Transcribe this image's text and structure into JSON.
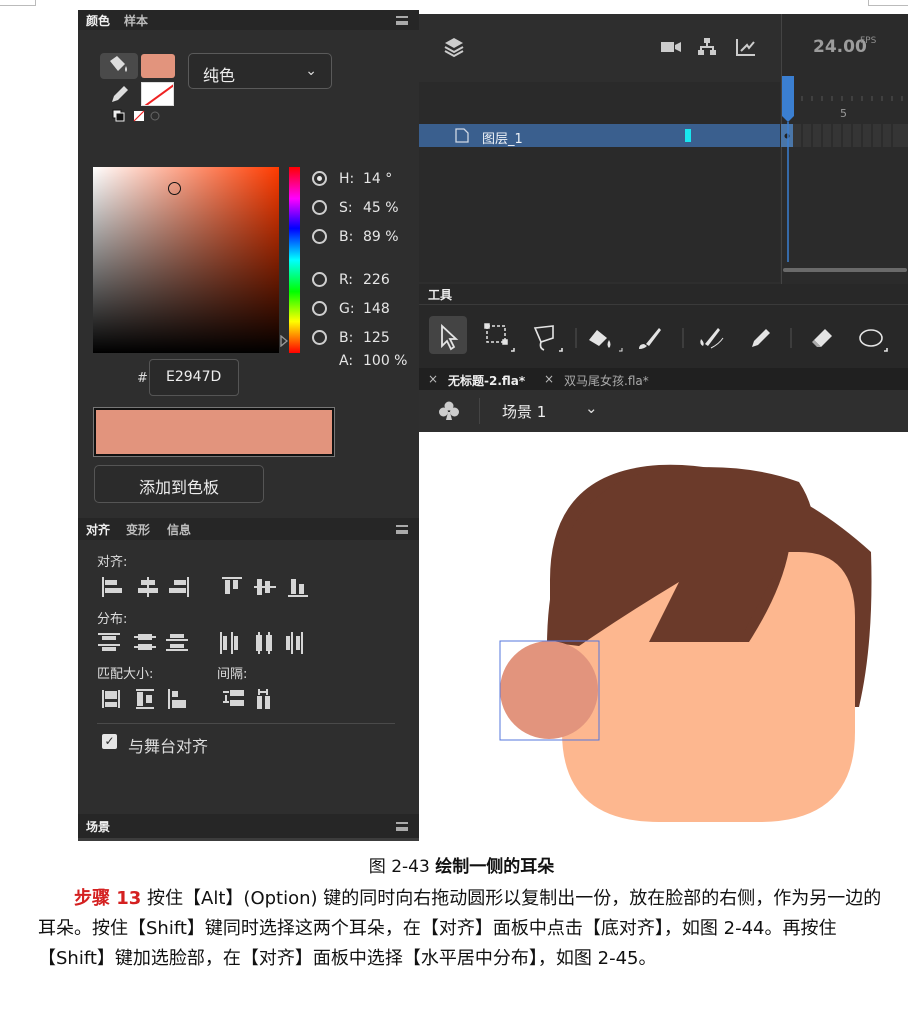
{
  "colors": {
    "fill": "#E2947D",
    "face": "#FDB78F",
    "hair": "#6B3A2A",
    "panel_bg": "#2E2E2E",
    "layer_selected": "#3A5F8E",
    "playhead": "#3B7FD1",
    "step_red": "#D42020"
  },
  "color_panel": {
    "tab_active": "颜色",
    "tab_other": "样本",
    "fill_type": "纯色",
    "hsb": [
      {
        "label": "H:",
        "value": "14 °",
        "selected": true
      },
      {
        "label": "S:",
        "value": "45 %",
        "selected": false
      },
      {
        "label": "B:",
        "value": "89 %",
        "selected": false
      }
    ],
    "rgb": [
      {
        "label": "R:",
        "value": "226"
      },
      {
        "label": "G:",
        "value": "148"
      },
      {
        "label": "B:",
        "value": "125"
      }
    ],
    "alpha_label": "A:",
    "alpha_value": "100 %",
    "hash": "#",
    "hex": "E2947D",
    "add_button": "添加到色板"
  },
  "align_panel": {
    "tabs": [
      "对齐",
      "变形",
      "信息"
    ],
    "align_label": "对齐:",
    "distribute_label": "分布:",
    "match_size_label": "匹配大小:",
    "spacing_label": "间隔:",
    "stage_align_label": "与舞台对齐",
    "stage_align_checked": true
  },
  "scene_panel": {
    "tab": "场景"
  },
  "timeline": {
    "fps": "24.00",
    "fps_unit": "FPS",
    "frame_marker": "5",
    "layer_name": "图层_1"
  },
  "tools_panel": {
    "title": "工具",
    "icons": [
      "selection-arrow-icon",
      "free-transform-icon",
      "lasso-icon",
      "paint-bucket-icon",
      "brush-icon",
      "fluid-brush-icon",
      "pencil-icon",
      "eraser-icon",
      "oval-icon"
    ]
  },
  "document": {
    "tabs": [
      "无标题-2.fla*",
      "双马尾女孩.fla*"
    ],
    "close_glyph": "×",
    "scene_name": "场景 1"
  },
  "caption": {
    "number": "图 2-43",
    "title": "绘制一侧的耳朵"
  },
  "paragraph": {
    "step": "步骤 13",
    "text": " 按住【Alt】(Option) 键的同时向右拖动圆形以复制出一份，放在脸部的右侧，作为另一边的耳朵。按住【Shift】键同时选择这两个耳朵，在【对齐】面板中点击【底对齐】，如图 2-44。再按住【Shift】键加选脸部，在【对齐】面板中选择【水平居中分布】，如图 2-45。"
  }
}
